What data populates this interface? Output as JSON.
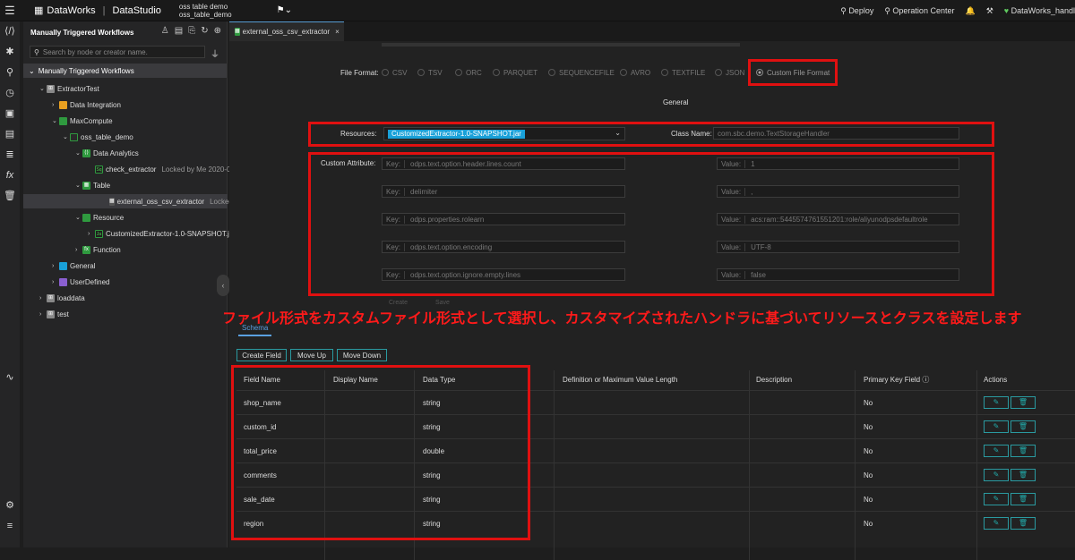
{
  "topbar": {
    "brand": "DataWorks",
    "product": "DataStudio",
    "tab_line1": "oss table demo",
    "tab_line2": "oss_table_demo",
    "deploy": "Deploy",
    "operation_center": "Operation Center",
    "workspace": "DataWorks_handl"
  },
  "sidebar": {
    "title": "Manually Triggered Workflows",
    "search_placeholder": "Search by node or creator name.",
    "root": "Manually Triggered Workflows",
    "nodes": {
      "extractortest": "ExtractorTest",
      "data_integration": "Data Integration",
      "maxcompute": "MaxCompute",
      "oss_table_demo": "oss_table_demo",
      "data_analytics": "Data Analytics",
      "check_extractor": "check_extractor",
      "check_extractor_lock": "Locked by Me  2020-0",
      "table": "Table",
      "external": "external_oss_csv_extractor",
      "external_lock": "Locked by",
      "resource": "Resource",
      "jar": "CustomizedExtractor-1.0-SNAPSHOT.jar",
      "function": "Function",
      "general": "General",
      "userdefined": "UserDefined",
      "loaddata": "loaddata",
      "test": "test"
    }
  },
  "editor": {
    "tab": "external_oss_csv_extractor",
    "file_format_label": "File Format:",
    "formats": [
      "CSV",
      "TSV",
      "ORC",
      "PARQUET",
      "SEQUENCEFILE",
      "AVRO",
      "TEXTFILE",
      "JSON",
      "Custom File Format"
    ],
    "general_title": "General",
    "resources_label": "Resources:",
    "resource_value": "CustomizedExtractor-1.0-SNAPSHOT.jar",
    "class_label": "Class Name:",
    "class_value": "com.sbc.demo.TextStorageHandler",
    "custom_attr_label": "Custom Attribute:",
    "key_label": "Key:",
    "value_label": "Value:",
    "attrs": [
      {
        "k": "odps.text.option.header.lines.count",
        "v": "1"
      },
      {
        "k": "delimiter",
        "v": ","
      },
      {
        "k": "odps.properties.rolearn",
        "v": "acs:ram::5445574761551201:role/aliyunodpsdefaultrole"
      },
      {
        "k": "odps.text.option.encoding",
        "v": "UTF-8"
      },
      {
        "k": "odps.text.option.ignore.empty.lines",
        "v": "false"
      }
    ],
    "create": "Create",
    "save": "Save",
    "annotation": "ファイル形式をカスタムファイル形式として選択し、カスタマイズされたハンドラに基づいてリソースとクラスを設定します",
    "schema_tab": "Schema",
    "create_field": "Create Field",
    "move_up": "Move Up",
    "move_down": "Move Down",
    "columns": [
      "Field Name",
      "Display Name",
      "Data Type",
      "Definition or Maximum Value Length",
      "Description",
      "Primary Key Field",
      "Actions"
    ],
    "rows": [
      {
        "name": "shop_name",
        "type": "string",
        "pk": "No"
      },
      {
        "name": "custom_id",
        "type": "string",
        "pk": "No"
      },
      {
        "name": "total_price",
        "type": "double",
        "pk": "No"
      },
      {
        "name": "comments",
        "type": "string",
        "pk": "No"
      },
      {
        "name": "sale_date",
        "type": "string",
        "pk": "No"
      },
      {
        "name": "region",
        "type": "string",
        "pk": "No"
      }
    ]
  },
  "colors": {
    "red": "#e01010",
    "accent": "#19a0d8",
    "teal": "#2a9aa0"
  }
}
